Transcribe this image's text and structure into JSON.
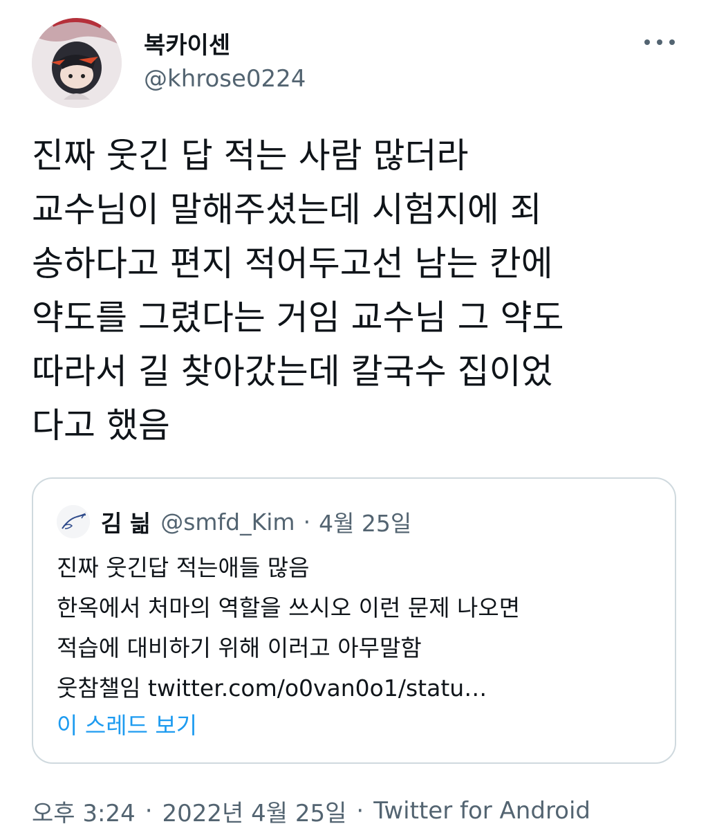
{
  "author": {
    "display_name": "복카이센",
    "handle": "@khrose0224",
    "avatar_icon": "avatar-image-icon"
  },
  "more_icon": "more-horizontal-icon",
  "tweet": {
    "lines": [
      "진짜 웃긴 답 적는 사람 많더라",
      "교수님이 말해주셨는데 시험지에 죄",
      "송하다고 편지 적어두고선 남는 칸에",
      "약도를 그렸다는 거임 교수님 그 약도",
      "따라서 길 찾아갔는데 칼국수 집이었",
      "다고 했음"
    ]
  },
  "quote": {
    "name": "김 늶",
    "handle": "@smfd_Kim",
    "separator": "·",
    "date": "4월 25일",
    "avatar_icon": "pen-avatar-icon",
    "lines": [
      "진짜 웃긴답 적는애들 많음",
      "한옥에서 처마의 역할을 쓰시오 이런 문제 나오면",
      "적습에 대비하기 위해 이러고 아무말함",
      "웃참챌임 twitter.com/o0van0o1/statu…"
    ],
    "show_thread": "이 스레드 보기"
  },
  "footer": {
    "time": "오후 3:24",
    "date": "2022년 4월 25일",
    "source": "Twitter for Android",
    "separator": "·"
  },
  "colors": {
    "text": "#0f1419",
    "secondary": "#536471",
    "link": "#1d9bf0",
    "border": "#cfd9de"
  }
}
